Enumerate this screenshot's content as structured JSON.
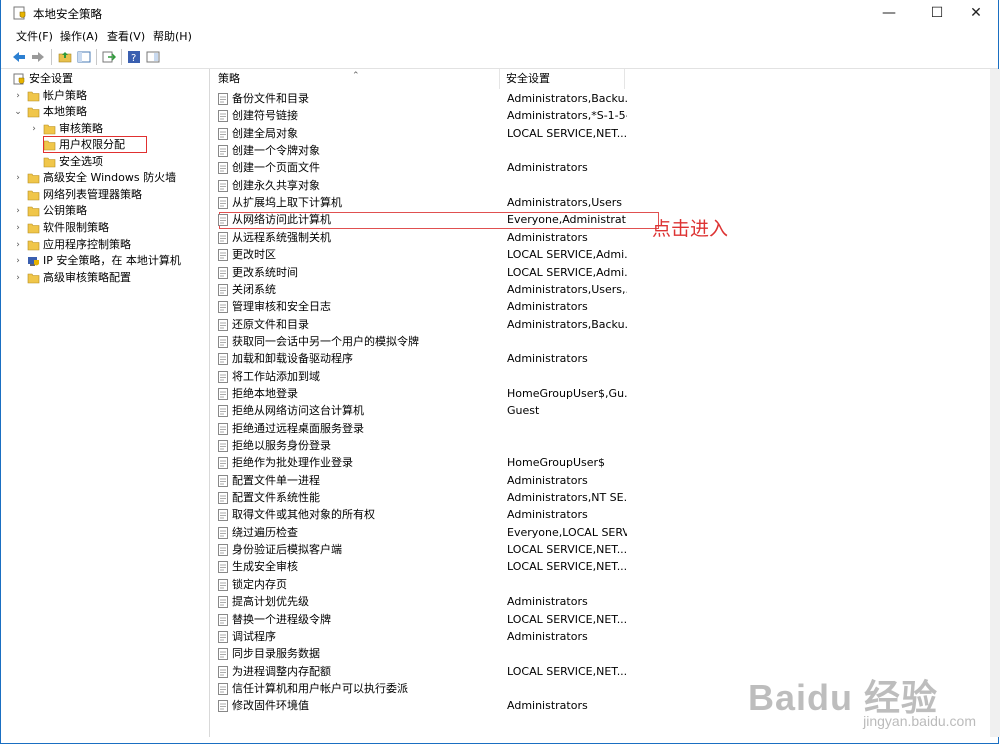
{
  "window": {
    "title": "本地安全策略"
  },
  "menu": [
    "文件(F)",
    "操作(A)",
    "查看(V)",
    "帮助(H)"
  ],
  "tree": [
    {
      "label": "安全设置",
      "level": 0,
      "arrow": "",
      "icon": "shield"
    },
    {
      "label": "帐户策略",
      "level": 1,
      "arrow": "›",
      "icon": "folder"
    },
    {
      "label": "本地策略",
      "level": 1,
      "arrow": "⌄",
      "icon": "folder-open"
    },
    {
      "label": "审核策略",
      "level": 2,
      "arrow": "›",
      "icon": "folder"
    },
    {
      "label": "用户权限分配",
      "level": 2,
      "arrow": "",
      "icon": "folder"
    },
    {
      "label": "安全选项",
      "level": 2,
      "arrow": "",
      "icon": "folder"
    },
    {
      "label": "高级安全 Windows 防火墙",
      "level": 1,
      "arrow": "›",
      "icon": "folder"
    },
    {
      "label": "网络列表管理器策略",
      "level": 1,
      "arrow": "",
      "icon": "folder"
    },
    {
      "label": "公钥策略",
      "level": 1,
      "arrow": "›",
      "icon": "folder"
    },
    {
      "label": "软件限制策略",
      "level": 1,
      "arrow": "›",
      "icon": "folder"
    },
    {
      "label": "应用程序控制策略",
      "level": 1,
      "arrow": "›",
      "icon": "folder"
    },
    {
      "label": "IP 安全策略，在 本地计算机",
      "level": 1,
      "arrow": "›",
      "icon": "ipsec"
    },
    {
      "label": "高级审核策略配置",
      "level": 1,
      "arrow": "›",
      "icon": "folder"
    }
  ],
  "columns": {
    "policy": "策略",
    "setting": "安全设置"
  },
  "policies": [
    {
      "name": "备份文件和目录",
      "value": "Administrators,Backu..."
    },
    {
      "name": "创建符号链接",
      "value": "Administrators,*S-1-5-..."
    },
    {
      "name": "创建全局对象",
      "value": "LOCAL SERVICE,NET..."
    },
    {
      "name": "创建一个令牌对象",
      "value": ""
    },
    {
      "name": "创建一个页面文件",
      "value": "Administrators"
    },
    {
      "name": "创建永久共享对象",
      "value": ""
    },
    {
      "name": "从扩展坞上取下计算机",
      "value": "Administrators,Users"
    },
    {
      "name": "从网络访问此计算机",
      "value": "Everyone,Administrat..."
    },
    {
      "name": "从远程系统强制关机",
      "value": "Administrators"
    },
    {
      "name": "更改时区",
      "value": "LOCAL SERVICE,Admi..."
    },
    {
      "name": "更改系统时间",
      "value": "LOCAL SERVICE,Admi..."
    },
    {
      "name": "关闭系统",
      "value": "Administrators,Users,..."
    },
    {
      "name": "管理审核和安全日志",
      "value": "Administrators"
    },
    {
      "name": "还原文件和目录",
      "value": "Administrators,Backu..."
    },
    {
      "name": "获取同一会话中另一个用户的模拟令牌",
      "value": ""
    },
    {
      "name": "加载和卸载设备驱动程序",
      "value": "Administrators"
    },
    {
      "name": "将工作站添加到域",
      "value": ""
    },
    {
      "name": "拒绝本地登录",
      "value": "HomeGroupUser$,Gu..."
    },
    {
      "name": "拒绝从网络访问这台计算机",
      "value": "Guest"
    },
    {
      "name": "拒绝通过远程桌面服务登录",
      "value": ""
    },
    {
      "name": "拒绝以服务身份登录",
      "value": ""
    },
    {
      "name": "拒绝作为批处理作业登录",
      "value": "HomeGroupUser$"
    },
    {
      "name": "配置文件单一进程",
      "value": "Administrators"
    },
    {
      "name": "配置文件系统性能",
      "value": "Administrators,NT SE..."
    },
    {
      "name": "取得文件或其他对象的所有权",
      "value": "Administrators"
    },
    {
      "name": "绕过遍历检查",
      "value": "Everyone,LOCAL SERV..."
    },
    {
      "name": "身份验证后模拟客户端",
      "value": "LOCAL SERVICE,NET..."
    },
    {
      "name": "生成安全审核",
      "value": "LOCAL SERVICE,NET..."
    },
    {
      "name": "锁定内存页",
      "value": ""
    },
    {
      "name": "提高计划优先级",
      "value": "Administrators"
    },
    {
      "name": "替换一个进程级令牌",
      "value": "LOCAL SERVICE,NET..."
    },
    {
      "name": "调试程序",
      "value": "Administrators"
    },
    {
      "name": "同步目录服务数据",
      "value": ""
    },
    {
      "name": "为进程调整内存配额",
      "value": "LOCAL SERVICE,NET..."
    },
    {
      "name": "信任计算机和用户帐户可以执行委派",
      "value": ""
    },
    {
      "name": "修改固件环境值",
      "value": "Administrators"
    }
  ],
  "annotation": "点击进入",
  "watermark": {
    "main": "Baidu 经验",
    "sub": "jingyan.baidu.com"
  },
  "colors": {
    "accent": "#1a6fc2",
    "highlight": "#e03030"
  }
}
